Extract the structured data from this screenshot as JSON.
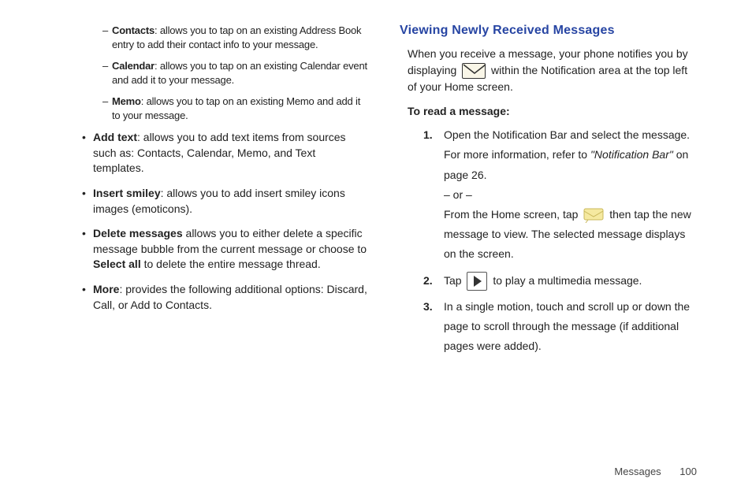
{
  "leftColumn": {
    "subItems": [
      {
        "label": "Contacts",
        "text": ": allows you to tap on an existing Address Book entry to add their contact info to your message."
      },
      {
        "label": "Calendar",
        "text": ": allows you to tap on an existing Calendar event and add it to your message."
      },
      {
        "label": "Memo",
        "text": ": allows you to tap on an existing Memo and add it to your message."
      }
    ],
    "bullets": [
      {
        "label": "Add text",
        "text": ": allows you to add text items from sources such as: Contacts, Calendar, Memo, and Text templates."
      },
      {
        "label": "Insert smiley",
        "text": ": allows you to add insert smiley icons images (emoticons)."
      },
      {
        "label": "Delete messages",
        "text": " allows you to either delete a specific message bubble from the current message or choose to ",
        "inlineBold": "Select all",
        "textAfter": " to delete the entire message thread."
      },
      {
        "label": "More",
        "text": ": provides the following additional options: Discard, Call, or Add to Contacts."
      }
    ]
  },
  "rightColumn": {
    "heading": "Viewing Newly Received Messages",
    "intro1": "When you receive a message, your phone notifies you by displaying ",
    "intro2": " within the Notification area at the top left of your Home screen.",
    "readLabel": "To read a message:",
    "steps": {
      "s1a": "Open the Notification Bar and select the message. For more information, refer to ",
      "s1ref": "\"Notification Bar\"",
      "s1b": "  on page 26.",
      "s1or": "– or –",
      "s1c": "From the Home screen, tap ",
      "s1d": " then tap the new message to view. The selected message displays on the screen.",
      "s2a": "Tap ",
      "s2b": " to play a multimedia message.",
      "s3": "In a single motion, touch and scroll up or down the page to scroll through the message (if additional pages were added)."
    }
  },
  "footer": {
    "section": "Messages",
    "page": "100"
  }
}
